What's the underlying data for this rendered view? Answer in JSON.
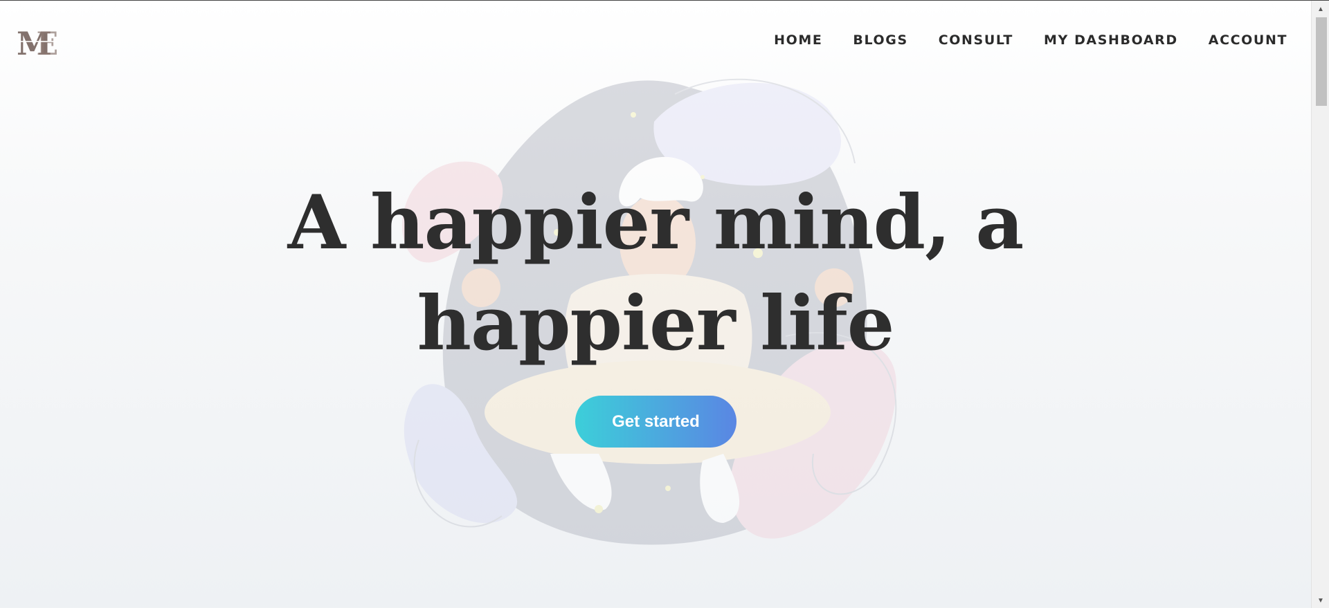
{
  "header": {
    "logo_text": "ME",
    "nav": [
      {
        "label": "HOME"
      },
      {
        "label": "BLOGS"
      },
      {
        "label": "CONSULT"
      },
      {
        "label": "MY DASHBOARD"
      },
      {
        "label": "ACCOUNT"
      }
    ]
  },
  "hero": {
    "title_line1": "A happier mind, a",
    "title_line2": "happier life",
    "cta_label": "Get started"
  },
  "colors": {
    "cta_gradient_start": "#3ccfd9",
    "cta_gradient_end": "#5a86e3",
    "text_dark": "#2e2e2e",
    "logo_brown": "#6e5a54"
  },
  "icons": {
    "logo": "me-monogram-logo",
    "scroll_up": "triangle-up-icon",
    "scroll_down": "triangle-down-icon"
  }
}
